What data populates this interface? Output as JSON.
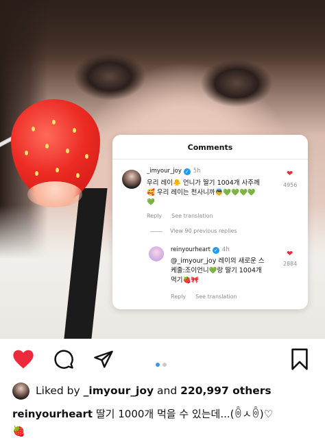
{
  "post": {
    "comments_card": {
      "title": "Comments",
      "comment": {
        "username": "_imyour_joy",
        "verified": true,
        "time": "5h",
        "text_line1": "우리 레이🐥 언니가 딸기 1004개 사주께",
        "text_line2": "🥰 우리 레이는 천사니까👼💚💚💚💚",
        "text_line3": "💚",
        "likes": "4956",
        "reply_label": "Reply",
        "translation_label": "See translation"
      },
      "view_replies": "View 90 previous replies",
      "reply": {
        "username": "reinyourheart",
        "verified": true,
        "time": "4h",
        "text_line1": "@_imyour_joy 레이의 새로운 스",
        "text_line2": "케줄:조이언니💚랑 딸기 1004개",
        "text_line3": "먹기🍓🎀",
        "likes": "2884",
        "reply_label": "Reply",
        "translation_label": "See translation"
      }
    }
  },
  "actions": {
    "like_icon": "heart-filled-icon",
    "comment_icon": "comment-icon",
    "share_icon": "send-icon",
    "save_icon": "bookmark-icon",
    "carousel_pages": 2,
    "carousel_active": 1,
    "accent_color": "#ed2a3c"
  },
  "likes": {
    "prefix": "Liked by",
    "user": "_imyour_joy",
    "middle": "and",
    "count": "220,997 others"
  },
  "caption": {
    "username": "reinyourheart",
    "text": "딸기 1000개 먹을 수 있는데...(ꉺㅅꉺ)♡",
    "emoji_line": "🍓"
  }
}
